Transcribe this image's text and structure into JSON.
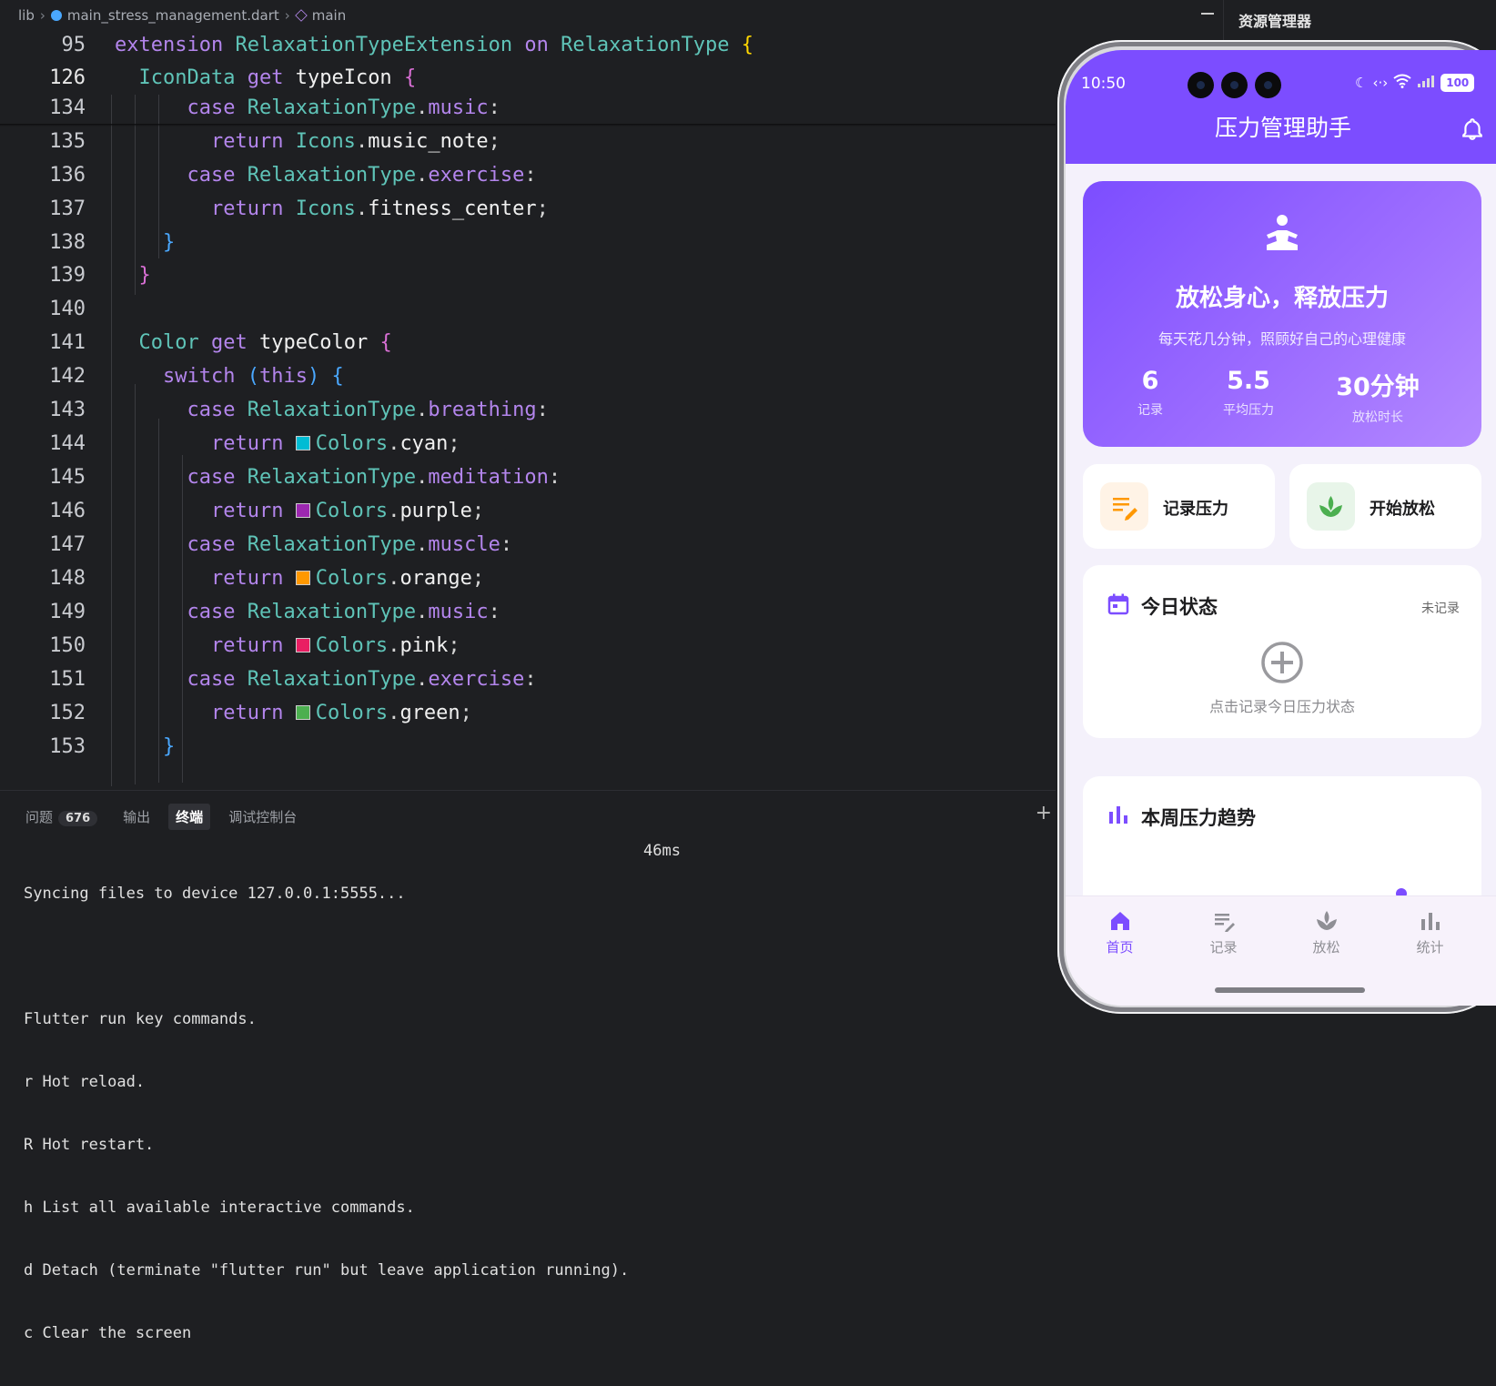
{
  "breadcrumb": {
    "root": "lib",
    "file": "main_stress_management.dart",
    "symbol": "main"
  },
  "code": {
    "lines": [
      {
        "n": "95"
      },
      {
        "n": "126"
      },
      {
        "n": "134"
      },
      {
        "n": "135"
      },
      {
        "n": "136"
      },
      {
        "n": "137"
      },
      {
        "n": "138"
      },
      {
        "n": "139"
      },
      {
        "n": "140"
      },
      {
        "n": "141"
      },
      {
        "n": "142"
      },
      {
        "n": "143"
      },
      {
        "n": "144"
      },
      {
        "n": "145"
      },
      {
        "n": "146"
      },
      {
        "n": "147"
      },
      {
        "n": "148"
      },
      {
        "n": "149"
      },
      {
        "n": "150"
      },
      {
        "n": "151"
      },
      {
        "n": "152"
      },
      {
        "n": "153"
      }
    ],
    "swatches": {
      "cyan": "#00bcd4",
      "purple": "#9c27b0",
      "orange": "#ff9800",
      "pink": "#e91e63",
      "green": "#4caf50"
    }
  },
  "panel": {
    "tabs": {
      "problems": "问题",
      "problems_count": "676",
      "output": "输出",
      "terminal": "终端",
      "debug": "调试控制台"
    },
    "add": "+",
    "terminal_lines": [
      "Syncing files to device 127.0.0.1:5555...",
      "",
      "Flutter run key commands.",
      "r Hot reload.",
      "R Hot restart.",
      "h List all available interactive commands.",
      "d Detach (terminate \"flutter run\" but leave application running).",
      "c Clear the screen"
    ],
    "terminal_time": "46ms"
  },
  "explorer": {
    "title": "资源管理器"
  },
  "phone": {
    "status": {
      "time": "10:50",
      "battery": "100"
    },
    "app_title": "压力管理助手",
    "hero": {
      "title": "放松身心，释放压力",
      "subtitle": "每天花几分钟，照顾好自己的心理健康",
      "stats": [
        {
          "value": "6",
          "label": "记录"
        },
        {
          "value": "5.5",
          "label": "平均压力"
        },
        {
          "value": "30分钟",
          "label": "放松时长"
        }
      ]
    },
    "quick": [
      {
        "label": "记录压力",
        "color": "#fff3e6",
        "icon_color": "#ff9800"
      },
      {
        "label": "开始放松",
        "color": "#e8f5e9",
        "icon_color": "#4caf50"
      }
    ],
    "today": {
      "title": "今日状态",
      "status": "未记录",
      "hint": "点击记录今日压力状态"
    },
    "trend": {
      "title": "本周压力趋势"
    },
    "nav": [
      {
        "label": "首页"
      },
      {
        "label": "记录"
      },
      {
        "label": "放松"
      },
      {
        "label": "统计"
      }
    ],
    "accent": "#7c4dff"
  }
}
